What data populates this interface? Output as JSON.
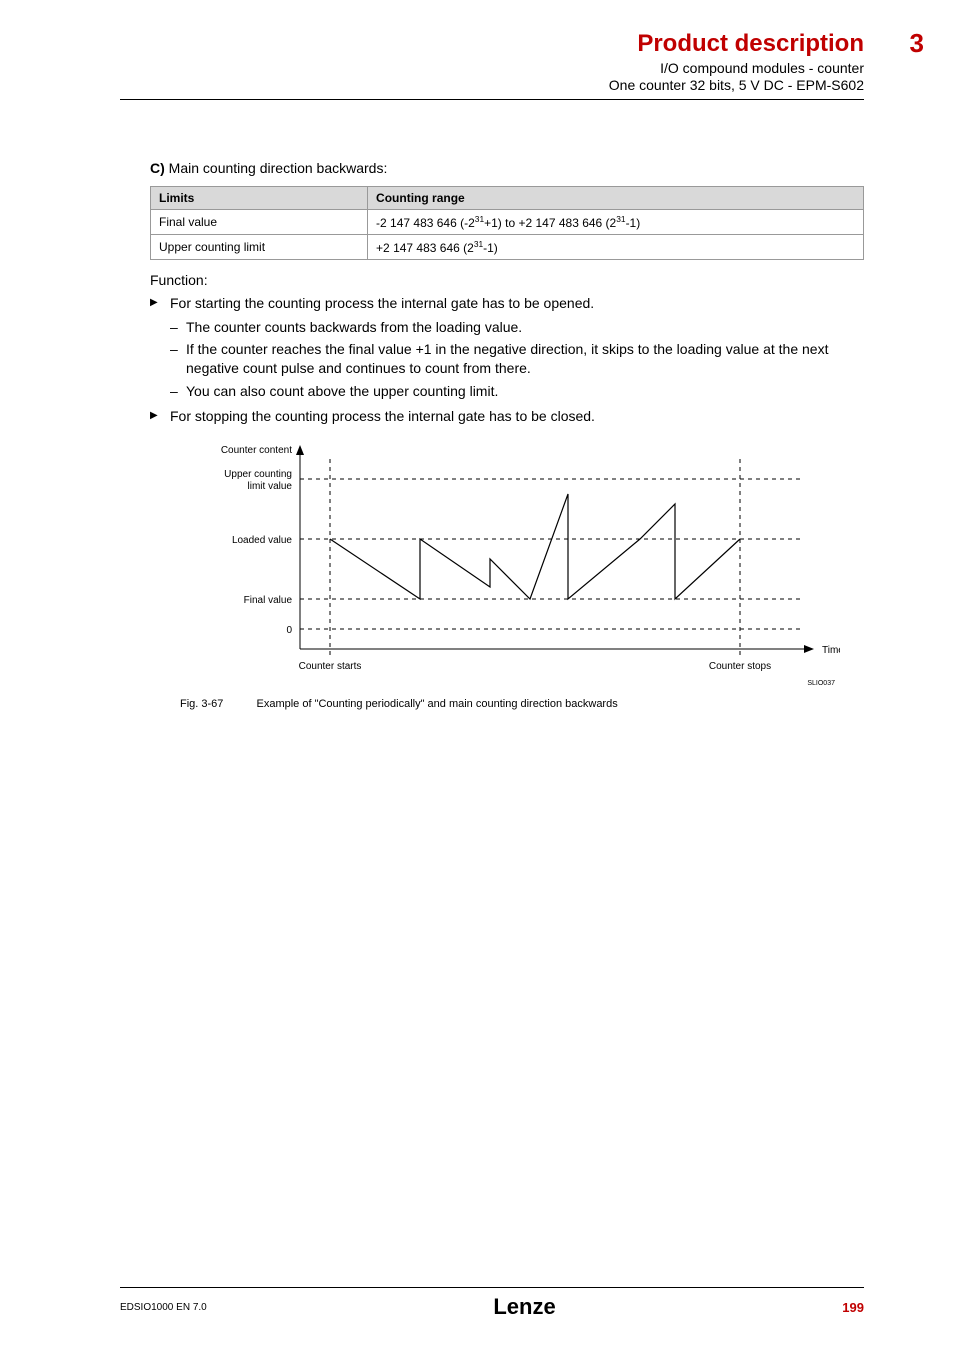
{
  "header": {
    "title": "Product description",
    "chapter": "3",
    "sub1": "I/O compound modules - counter",
    "sub2": "One counter 32 bits, 5 V DC - EPM-S602"
  },
  "section_c": {
    "label": "C)",
    "text": "Main counting direction backwards:"
  },
  "table": {
    "head_limits": "Limits",
    "head_range": "Counting range",
    "row1_l": "Final value",
    "row1_r_prefix": "-2 147 483 646 (-2",
    "row1_r_sup1": "31",
    "row1_r_mid": "+1) to +2 147 483 646 (2",
    "row1_r_sup2": "31",
    "row1_r_suffix": "-1)",
    "row2_l": "Upper counting limit",
    "row2_r_prefix": "+2 147 483 646 (2",
    "row2_r_sup": "31",
    "row2_r_suffix": "-1)"
  },
  "function_label": "Function:",
  "bullet1": "For starting the counting process the internal gate has to be opened.",
  "sub1": "The counter counts backwards from the loading value.",
  "sub2": "If the counter reaches the final value +1 in the negative direction, it skips to the loading value at the next negative count pulse and continues to count from there.",
  "sub3": "You can also count above the upper counting limit.",
  "bullet2": "For stopping the counting process the internal gate has to be closed.",
  "chart": {
    "y_counter_content": "Counter content",
    "y_upper1": "Upper counting",
    "y_upper2": "limit value",
    "y_loaded": "Loaded value",
    "y_final": "Final value",
    "y_zero": "0",
    "x_time": "Time",
    "x_starts": "Counter starts",
    "x_stops": "Counter stops",
    "code": "SLIO037"
  },
  "caption": {
    "fig": "Fig. 3-67",
    "text": "Example of \"Counting periodically\" and main counting direction backwards"
  },
  "footer": {
    "left": "EDSIO1000 EN 7.0",
    "center": "Lenze",
    "right": "199"
  },
  "chart_data": {
    "type": "line",
    "title": "Example of \"Counting periodically\" and main counting direction backwards",
    "xlabel": "Time",
    "ylabel": "Counter content",
    "y_levels": {
      "upper_counting_limit_value": 3,
      "loaded_value": 2,
      "final_value": 1,
      "zero": 0
    },
    "x_markers": {
      "counter_starts": 0,
      "counter_stops": 10
    },
    "series": [
      {
        "name": "counter",
        "x": [
          0.0,
          2.2,
          2.2,
          3.9,
          3.9,
          4.9,
          5.8,
          5.8,
          7.6,
          8.4,
          8.4,
          10.0
        ],
        "y": [
          2.0,
          1.0,
          2.0,
          1.2,
          1.7,
          1.0,
          2.8,
          1.0,
          2.0,
          2.6,
          1.0,
          2.0
        ]
      }
    ],
    "xlim": [
      0,
      10.5
    ],
    "ylim": [
      -0.5,
      3.2
    ]
  }
}
